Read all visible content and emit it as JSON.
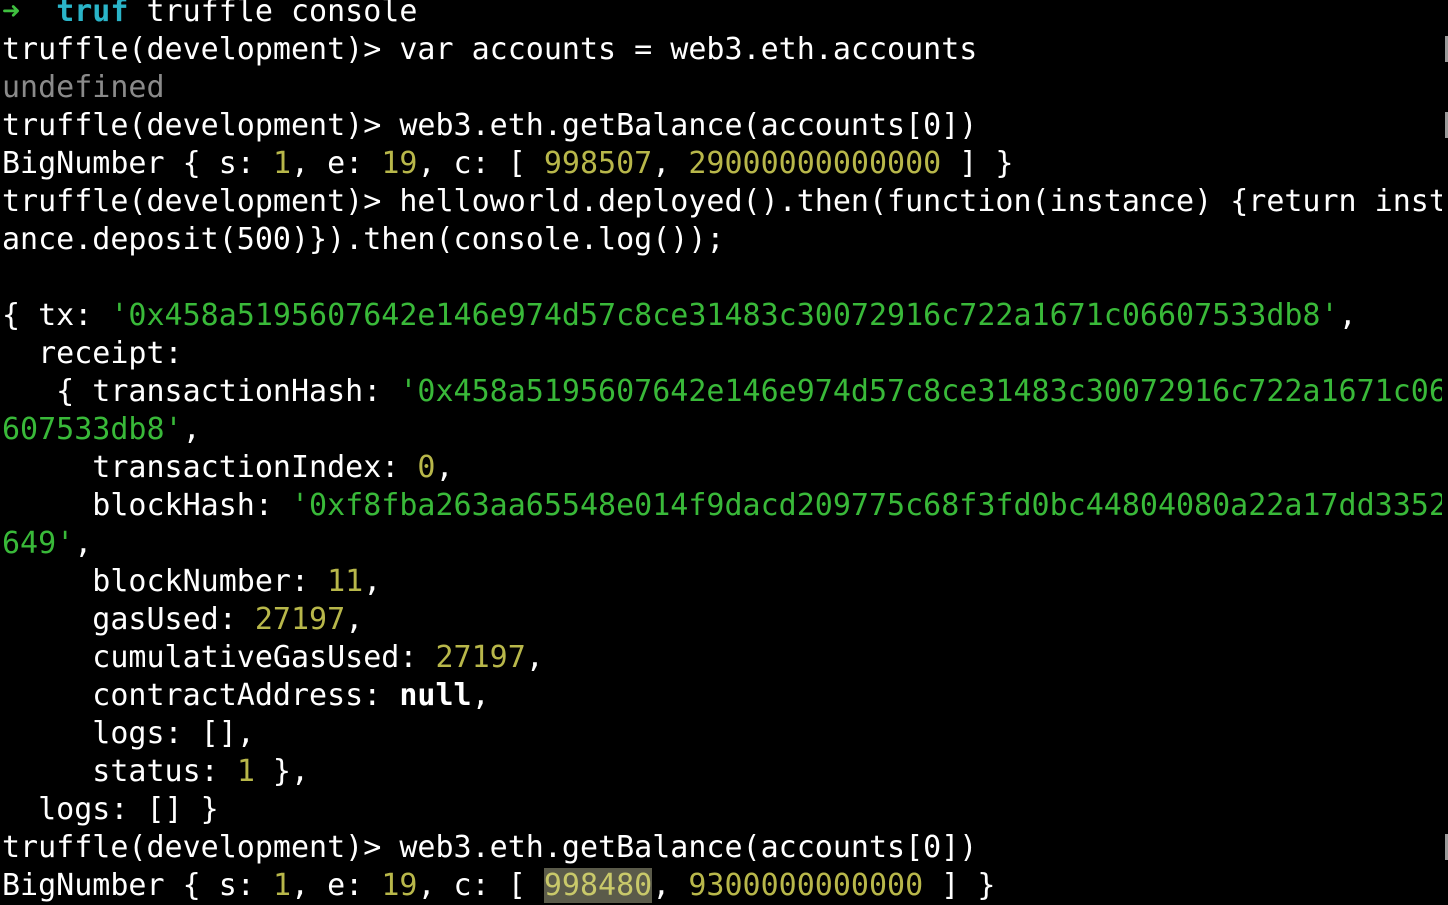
{
  "header": {
    "arrow": "➜",
    "dir": "truf",
    "command": "truffle console"
  },
  "prompt": "truffle(development)> ",
  "session": {
    "cmd1": "var accounts = web3.eth.accounts",
    "out1": "undefined",
    "cmd2": "web3.eth.getBalance(accounts[0])",
    "bn1": {
      "prefix": "BigNumber { s: ",
      "s": "1",
      "e_label": ", e: ",
      "e": "19",
      "c_label": ", c: [ ",
      "c0": "998507",
      "sep": ", ",
      "c1": "29000000000000",
      "suffix": " ] }"
    },
    "cmd3_line1": "helloworld.deployed().then(function(instance) {return inst",
    "cmd3_line2": "ance.deposit(500)}).then(console.log());",
    "tx_label": "{ tx: ",
    "tx_value": "'0x458a5195607642e146e974d57c8ce31483c30072916c722a1671c06607533db8'",
    "comma": ",",
    "receipt_label": "  receipt:",
    "txhash_label": "   { transactionHash: ",
    "txhash_value_1": "'0x458a5195607642e146e974d57c8ce31483c30072916c722a1671c06",
    "txhash_value_2": "607533db8'",
    "txindex_label": "     transactionIndex: ",
    "txindex_value": "0",
    "blockhash_label": "     blockHash: ",
    "blockhash_value_1": "'0xf8fba263aa65548e014f9dacd209775c68f3fd0bc44804080a22a17dd3352",
    "blockhash_value_2": "649'",
    "blocknumber_label": "     blockNumber: ",
    "blocknumber_value": "11",
    "gasused_label": "     gasUsed: ",
    "gasused_value": "27197",
    "cumgas_label": "     cumulativeGasUsed: ",
    "cumgas_value": "27197",
    "contract_label": "     contractAddress: ",
    "contract_value": "null",
    "logs_label": "     logs: [],",
    "status_label": "     status: ",
    "status_value": "1",
    "status_end": " },",
    "outer_logs": "  logs: [] }",
    "cmd4": "web3.eth.getBalance(accounts[0])",
    "bn2": {
      "prefix": "BigNumber { s: ",
      "s": "1",
      "e_label": ", e: ",
      "e": "19",
      "c_label": ", c: [ ",
      "c0": "998480",
      "sep": ", ",
      "c1": "9300000000000",
      "suffix": " ] }"
    }
  }
}
